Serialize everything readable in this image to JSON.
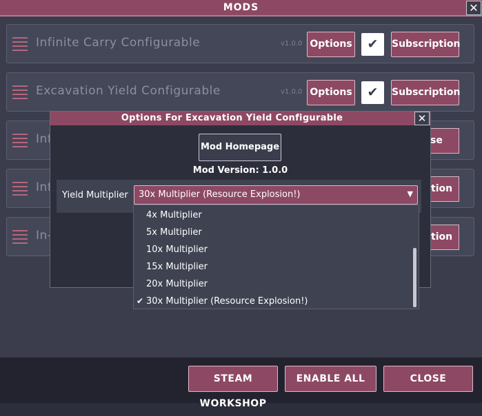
{
  "window": {
    "title": "MODS",
    "close_glyph": "✕"
  },
  "mods": [
    {
      "name": "Infinite Carry Configurable",
      "version": "v1.0.0",
      "options_label": "Options",
      "enabled": true,
      "subscription_label": "Subscription"
    },
    {
      "name": "Excavation Yield Configurable",
      "version": "v1.0.0",
      "options_label": "Options",
      "enabled": true,
      "subscription_label": "Subscription"
    },
    {
      "name": "Inf",
      "partial_button": "se"
    },
    {
      "name": "Inf",
      "partial_button": "ption"
    },
    {
      "name": "In-",
      "partial_button": "ption"
    }
  ],
  "dialog": {
    "title": "Options For Excavation Yield Configurable",
    "close_glyph": "✕",
    "homepage_label": "Mod Homepage",
    "mod_version": "Mod Version: 1.0.0",
    "yield_label": "Yield Multiplier",
    "selected": "30x Multiplier (Resource Explosion!)",
    "arrow_glyph": "▼",
    "check_glyph": "✔",
    "options": [
      {
        "label": "4x Multiplier",
        "checked": false
      },
      {
        "label": "5x Multiplier",
        "checked": false
      },
      {
        "label": "10x Multiplier",
        "checked": false
      },
      {
        "label": "15x Multiplier",
        "checked": false
      },
      {
        "label": "20x Multiplier",
        "checked": false
      },
      {
        "label": "30x Multiplier (Resource Explosion!)",
        "checked": true
      }
    ]
  },
  "footer": {
    "steam_workshop": "STEAM WORKSHOP",
    "enable_all": "ENABLE ALL",
    "close": "CLOSE"
  },
  "colors": {
    "accent": "#8d4963",
    "panel": "#3b3d4c",
    "row": "#444757",
    "footer": "#22232e"
  }
}
